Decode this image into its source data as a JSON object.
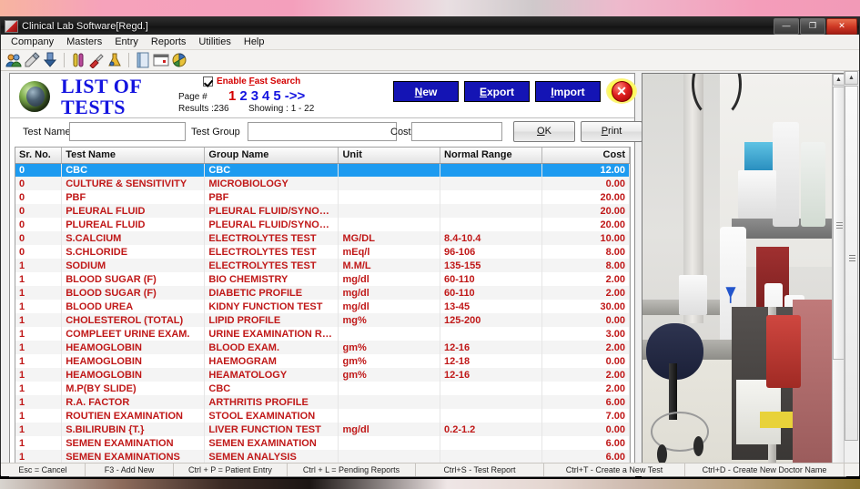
{
  "window": {
    "title": "Clinical Lab Software[Regd.]",
    "minimize_label": "—",
    "maximize_label": "❐",
    "close_label": "✕"
  },
  "menubar": {
    "items": [
      {
        "label": "Company"
      },
      {
        "label": "Masters"
      },
      {
        "label": "Entry"
      },
      {
        "label": "Reports"
      },
      {
        "label": "Utilities"
      },
      {
        "label": "Help"
      }
    ]
  },
  "toolbar": {
    "icons": [
      {
        "name": "users-icon"
      },
      {
        "name": "patient-entry-icon"
      },
      {
        "name": "download-icon"
      },
      {
        "name": "test-tubes-icon"
      },
      {
        "name": "syringe-icon"
      },
      {
        "name": "flask-icon"
      },
      {
        "name": "report-icon"
      },
      {
        "name": "calendar-icon"
      },
      {
        "name": "chart-icon"
      }
    ]
  },
  "panel": {
    "heading_line1": "LIST OF",
    "heading_line2": "TESTS",
    "page_label": "Page #",
    "pages": [
      "1",
      "2",
      "3",
      "4",
      "5",
      "->>"
    ],
    "current_page": "1",
    "results_label": "Results :236",
    "showing_label": "Showing :  1 - 22",
    "fast_search": {
      "checked": true,
      "label_pre": "Enable ",
      "label_underline": "F",
      "label_post": "ast Search",
      "color": "#d40000"
    },
    "buttons": {
      "new": {
        "underline": "N",
        "rest": "ew"
      },
      "export": {
        "underline": "E",
        "rest": "xport"
      },
      "import": {
        "underline": "I",
        "rest": "mport"
      },
      "close": "✕"
    },
    "accent_blue": "#1414b4",
    "heading_color": "#1414e0"
  },
  "filters": {
    "test_name_label": "Test Name",
    "test_name_value": "",
    "test_name_placeholder": "",
    "test_group_label": "Test Group",
    "test_group_value": "",
    "test_group_placeholder": "",
    "cost_label": "Cost",
    "cost_value": "",
    "cost_placeholder": "",
    "ok": {
      "underline": "O",
      "rest": "K"
    },
    "print": {
      "underline": "P",
      "rest": "rint"
    }
  },
  "grid": {
    "columns": [
      "Sr. No.",
      "Test Name",
      "Group Name",
      "Unit",
      "Normal Range",
      "Cost"
    ],
    "selected_row_index": 0,
    "rows": [
      {
        "sr": "0",
        "test": "CBC",
        "group": "CBC",
        "unit": "",
        "range": "",
        "cost": "12.00"
      },
      {
        "sr": "0",
        "test": "CULTURE & SENSITIVITY",
        "group": "MICROBIOLOGY",
        "unit": "",
        "range": "",
        "cost": "0.00"
      },
      {
        "sr": "0",
        "test": "PBF",
        "group": "PBF",
        "unit": "",
        "range": "",
        "cost": "20.00"
      },
      {
        "sr": "0",
        "test": "PLEURAL FLUID",
        "group": "PLEURAL FLUID/SYNOVI...",
        "unit": "",
        "range": "",
        "cost": "20.00"
      },
      {
        "sr": "0",
        "test": "PLUREAL FLUID",
        "group": "PLEURAL FLUID/SYNOVI...",
        "unit": "",
        "range": "",
        "cost": "20.00"
      },
      {
        "sr": "0",
        "test": "S.CALCIUM",
        "group": "ELECTROLYTES TEST",
        "unit": "MG/DL",
        "range": "8.4-10.4",
        "cost": "10.00"
      },
      {
        "sr": "0",
        "test": "S.CHLORIDE",
        "group": "ELECTROLYTES TEST",
        "unit": "mEq/l",
        "range": "96-106",
        "cost": "8.00"
      },
      {
        "sr": "1",
        "test": " SODIUM",
        "group": "ELECTROLYTES TEST",
        "unit": "M.M/L",
        "range": "135-155",
        "cost": "8.00"
      },
      {
        "sr": "1",
        "test": "BLOOD SUGAR (F)",
        "group": "BIO CHEMISTRY",
        "unit": "mg/dl",
        "range": "60-110",
        "cost": "2.00"
      },
      {
        "sr": "1",
        "test": "BLOOD SUGAR (F)",
        "group": "DIABETIC PROFILE",
        "unit": "mg/dl",
        "range": "60-110",
        "cost": "2.00"
      },
      {
        "sr": "1",
        "test": "BLOOD UREA",
        "group": "KIDNY FUNCTION TEST",
        "unit": "mg/dl",
        "range": "13-45",
        "cost": "30.00"
      },
      {
        "sr": "1",
        "test": "CHOLESTEROL (TOTAL)",
        "group": "LIPID PROFILE",
        "unit": "mg%",
        "range": "125-200",
        "cost": "0.00"
      },
      {
        "sr": "1",
        "test": "COMPLEET URINE EXAM.",
        "group": "URINE EXAMINATION RE...",
        "unit": "",
        "range": "",
        "cost": "3.00"
      },
      {
        "sr": "1",
        "test": "HEAMOGLOBIN",
        "group": "BLOOD EXAM.",
        "unit": "gm%",
        "range": "12-16",
        "cost": "2.00"
      },
      {
        "sr": "1",
        "test": "HEAMOGLOBIN",
        "group": "HAEMOGRAM",
        "unit": "gm%",
        "range": "12-18",
        "cost": "0.00"
      },
      {
        "sr": "1",
        "test": "HEAMOGLOBIN",
        "group": "HEAMATOLOGY",
        "unit": "gm%",
        "range": "12-16",
        "cost": "2.00"
      },
      {
        "sr": "1",
        "test": "M.P(BY SLIDE)",
        "group": "CBC",
        "unit": "",
        "range": "",
        "cost": "2.00"
      },
      {
        "sr": "1",
        "test": "R.A. FACTOR",
        "group": "ARTHRITIS PROFILE",
        "unit": "",
        "range": "",
        "cost": "6.00"
      },
      {
        "sr": "1",
        "test": "ROUTIEN EXAMINATION",
        "group": "STOOL EXAMINATION",
        "unit": "",
        "range": "",
        "cost": "7.00"
      },
      {
        "sr": "1",
        "test": "S.BILIRUBIN {T.}",
        "group": "LIVER FUNCTION TEST",
        "unit": "mg/dl",
        "range": "0.2-1.2",
        "cost": "0.00"
      },
      {
        "sr": "1",
        "test": "SEMEN EXAMINATION",
        "group": "SEMEN EXAMINATION",
        "unit": "",
        "range": "",
        "cost": "6.00"
      },
      {
        "sr": "1",
        "test": "SEMEN EXAMINATIONS",
        "group": "SEMEN ANALYSIS",
        "unit": "",
        "range": "",
        "cost": "6.00"
      }
    ]
  },
  "photo": {
    "name": "laboratory-bench-photo",
    "description": "Photograph of a clinical laboratory bench with stool, shelves, bottles and red sharps container"
  },
  "statusbar": {
    "cells": [
      "Esc = Cancel",
      "F3 - Add New",
      "Ctrl + P = Patient Entry",
      "Ctrl + L = Pending Reports",
      "Ctrl+S - Test Report",
      "Ctrl+T  -  Create a New Test",
      "Ctrl+D - Create New Doctor Name"
    ]
  }
}
